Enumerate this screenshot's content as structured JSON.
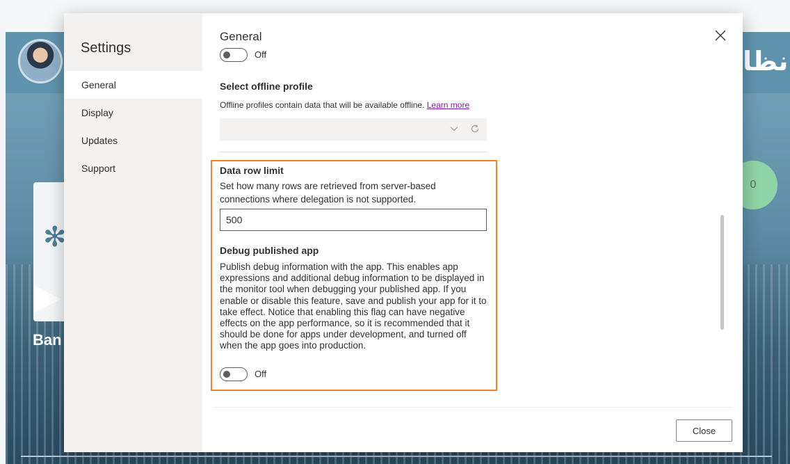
{
  "background": {
    "title": "نظا",
    "brand_text": "Ban",
    "badge_count": "0"
  },
  "dialog": {
    "sidebar": {
      "title": "Settings",
      "items": [
        {
          "label": "General",
          "active": true
        },
        {
          "label": "Display",
          "active": false
        },
        {
          "label": "Updates",
          "active": false
        },
        {
          "label": "Support",
          "active": false
        }
      ]
    },
    "content": {
      "heading": "General",
      "top_toggle": {
        "state": "Off"
      },
      "offline_profile": {
        "title": "Select offline profile",
        "description": "Offline profiles contain data that will be available offline.",
        "learn_more": "Learn more",
        "selected_value": ""
      },
      "data_row_limit": {
        "title": "Data row limit",
        "description": "Set how many rows are retrieved from server-based connections where delegation is not supported.",
        "value": "500"
      },
      "debug_published_app": {
        "title": "Debug published app",
        "description": "Publish debug information with the app. This enables app expressions and additional debug information to be displayed in the monitor tool when debugging your published app. If you enable or disable this feature, save and publish your app for it to take effect. Notice that enabling this flag can have negative effects on the app performance, so it is recommended that it should be done for apps under development, and turned off when the app goes into production.",
        "toggle_state": "Off"
      }
    },
    "footer": {
      "close_label": "Close"
    }
  },
  "colors": {
    "highlight_border": "#f2822a",
    "link": "#8019a8",
    "sidebar_bg": "#f3f2f1"
  }
}
